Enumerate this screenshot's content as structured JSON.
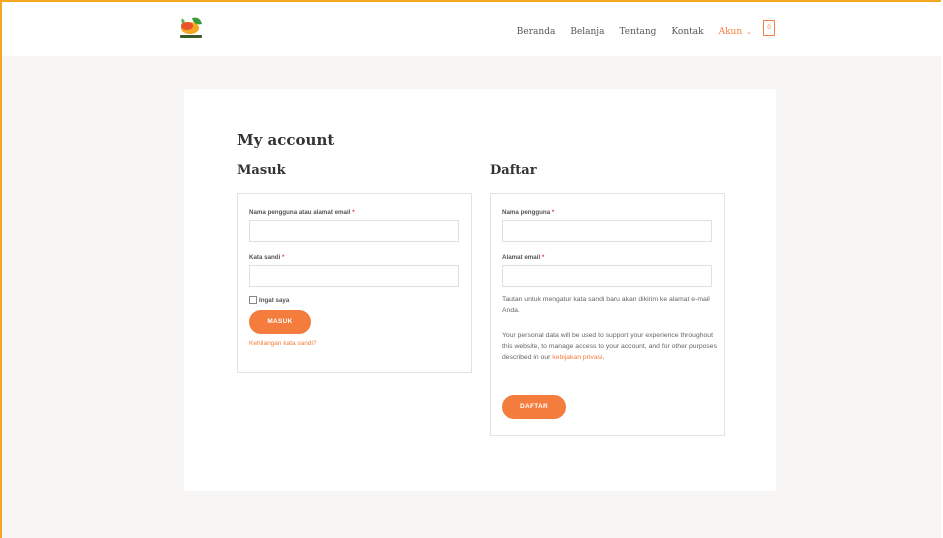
{
  "header": {
    "nav": [
      "Beranda",
      "Belanja",
      "Tentang",
      "Kontak"
    ],
    "active_nav": "Akun",
    "cart_count": "0",
    "colors": {
      "accent": "#f47c3c",
      "frame": "#f5a623"
    }
  },
  "page": {
    "title": "My account"
  },
  "login": {
    "title": "Masuk",
    "username_label": "Nama pengguna atau alamat email",
    "password_label": "Kata sandi",
    "required_mark": "*",
    "remember_label": "Ingat saya",
    "submit_label": "MASUK",
    "lost_password_link": "Kehilangan kata sandi?"
  },
  "register": {
    "title": "Daftar",
    "username_label": "Nama pengguna",
    "email_label": "Alamat email",
    "required_mark": "*",
    "password_note": "Tautan untuk mengatur kata sandi baru akan dikirim ke alamat e-mail Anda.",
    "privacy_text": "Your personal data will be used to support your experience throughout this website, to manage access to your account, and for other purposes described in our",
    "privacy_link": "kebijakan privasi",
    "privacy_end": ".",
    "submit_label": "DAFTAR"
  }
}
